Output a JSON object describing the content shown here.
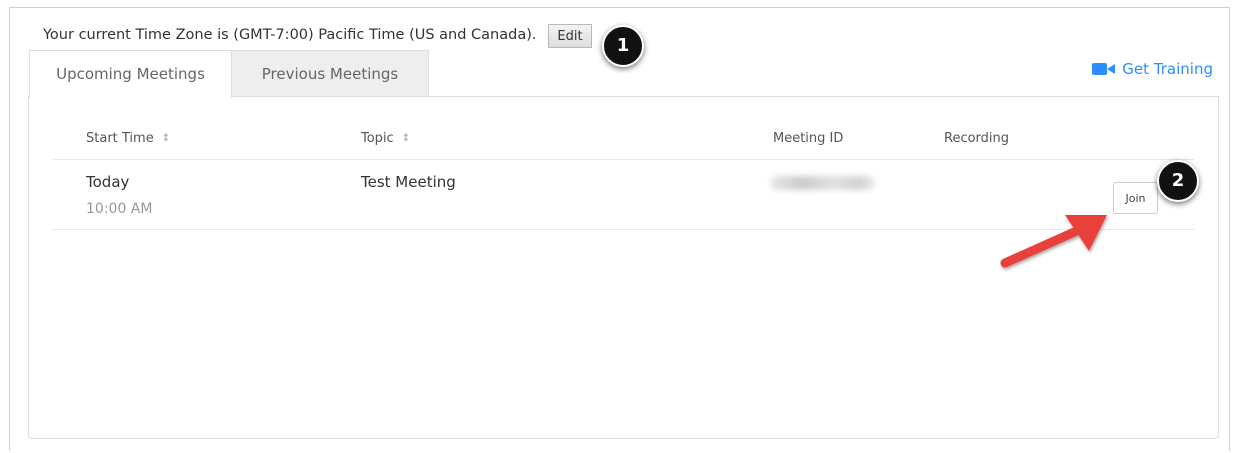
{
  "timezone": {
    "text": "Your current Time Zone is (GMT-7:00) Pacific Time (US and Canada).",
    "edit_label": "Edit"
  },
  "callouts": {
    "one": "1",
    "two": "2"
  },
  "tabs": [
    {
      "label": "Upcoming Meetings",
      "active": true
    },
    {
      "label": "Previous Meetings",
      "active": false
    }
  ],
  "get_training": {
    "label": "Get Training",
    "icon": "video-camera-icon",
    "color": "#2d8cff"
  },
  "table": {
    "columns": [
      {
        "label": "Start Time",
        "sortable": true
      },
      {
        "label": "Topic",
        "sortable": true
      },
      {
        "label": "Meeting ID",
        "sortable": false
      },
      {
        "label": "Recording",
        "sortable": false
      }
    ],
    "rows": [
      {
        "date": "Today",
        "time": "10:00 AM",
        "topic": "Test Meeting",
        "meeting_id": "",
        "recording": "",
        "action_label": "Join"
      }
    ]
  },
  "annotation": {
    "arrow_color": "#e8403a"
  }
}
